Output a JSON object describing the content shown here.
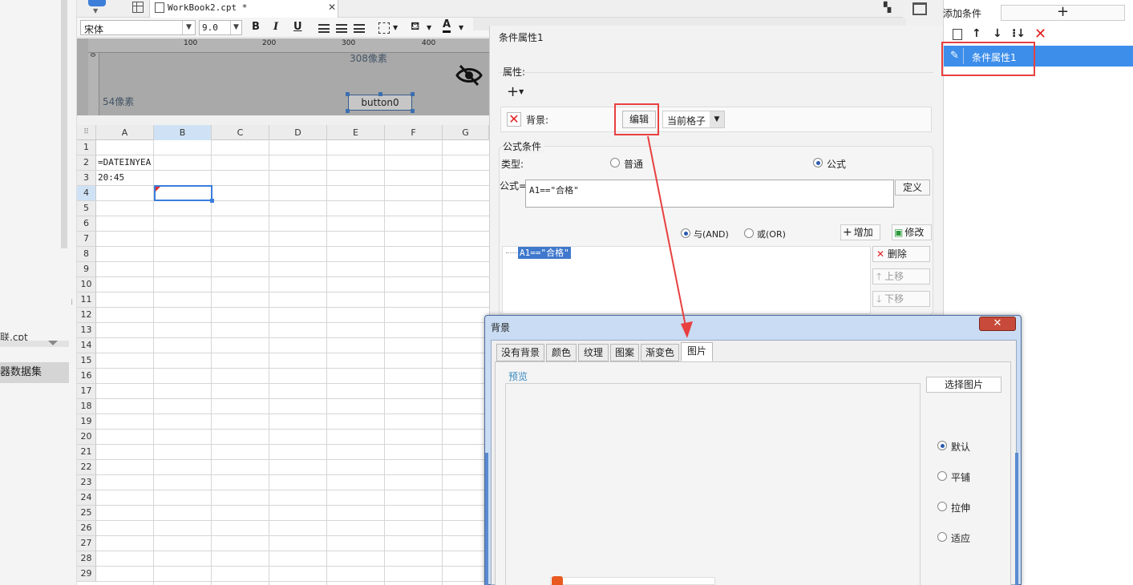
{
  "left_panel": {
    "file_label": "联.cpt",
    "dataset_label": "器数据集"
  },
  "tabs": {
    "doc_title": "WorkBook2.cpt *",
    "close_glyph": "✕"
  },
  "format_bar": {
    "font": "宋体",
    "size": "9.0",
    "bold": "B",
    "italic": "I",
    "underline": "U",
    "font_color": "A"
  },
  "ruler": {
    "ticks": [
      "100",
      "200",
      "300",
      "400"
    ],
    "zero": "0",
    "width_label": "308像素",
    "height_label": "54像素"
  },
  "widget": {
    "label": "button0"
  },
  "grid": {
    "columns": [
      "A",
      "B",
      "C",
      "D",
      "E",
      "F",
      "G"
    ],
    "rows": [
      "1",
      "2",
      "3",
      "4",
      "5",
      "6",
      "7",
      "8",
      "9",
      "10",
      "11",
      "12",
      "13",
      "14",
      "15",
      "16",
      "17",
      "18",
      "19",
      "20",
      "21",
      "22",
      "23",
      "24",
      "25",
      "26",
      "27",
      "28",
      "29"
    ],
    "cells": {
      "A2": "=DATEINYEA",
      "A3": "20:45"
    }
  },
  "cond_panel": {
    "title": "条件属性1",
    "attr_label": "属性:",
    "bg_label": "背景:",
    "edit_label": "编辑",
    "scope": "当前格子",
    "formula_group": "公式条件",
    "type_label": "类型:",
    "type_normal": "普通",
    "type_formula": "公式",
    "formula_label": "公式=",
    "formula_value": "A1==\"合格\"",
    "define_label": "定义",
    "and_label": "与(AND)",
    "or_label": "或(OR)",
    "add_label": "增加",
    "modify_label": "修改",
    "condition_item": "A1==\"合格\"",
    "delete_label": "删除",
    "move_up_label": "上移",
    "move_down_label": "下移"
  },
  "right_panel": {
    "add_label": "添加条件",
    "add_glyph": "+",
    "item_label": "条件属性1"
  },
  "bg_dialog": {
    "title": "背景",
    "close_glyph": "✕",
    "tabs": [
      "没有背景",
      "颜色",
      "纹理",
      "图案",
      "渐变色",
      "图片"
    ],
    "active_tab": "图片",
    "preview_label": "预览",
    "choose_label": "选择图片",
    "options": [
      "默认",
      "平铺",
      "拉伸",
      "适应"
    ]
  },
  "colors": {
    "accent": "#3d8eea",
    "highlight": "#e84040",
    "selection": "#3f78cc"
  }
}
